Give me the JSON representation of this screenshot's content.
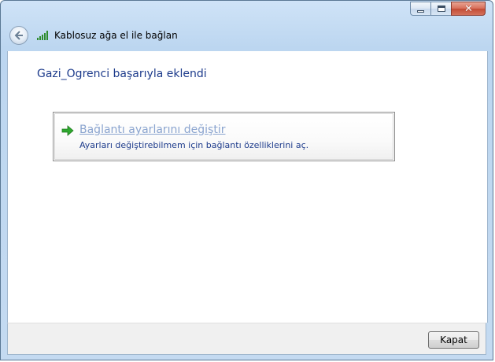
{
  "window": {
    "title": "Kablosuz ağa el ile bağlan"
  },
  "caption_buttons": {
    "close_glyph": "✕"
  },
  "icons": {
    "back": "back-arrow-icon",
    "network": "wireless-signal-icon",
    "command_arrow": "green-arrow-icon"
  },
  "main": {
    "heading": "Gazi_Ogrenci başarıyla eklendi",
    "command_link": {
      "title_underlined": "Bağlantı ayarlarını",
      "title_rest": " değiştir",
      "description": "Ayarları değiştirebilmem için bağlantı özelliklerini aç."
    }
  },
  "footer": {
    "close_label": "Kapat"
  },
  "colors": {
    "heading": "#1e3c8c",
    "link_title": "#8aa4cf",
    "arrow_green": "#2ea82e",
    "close_button_red": "#c24b34"
  }
}
